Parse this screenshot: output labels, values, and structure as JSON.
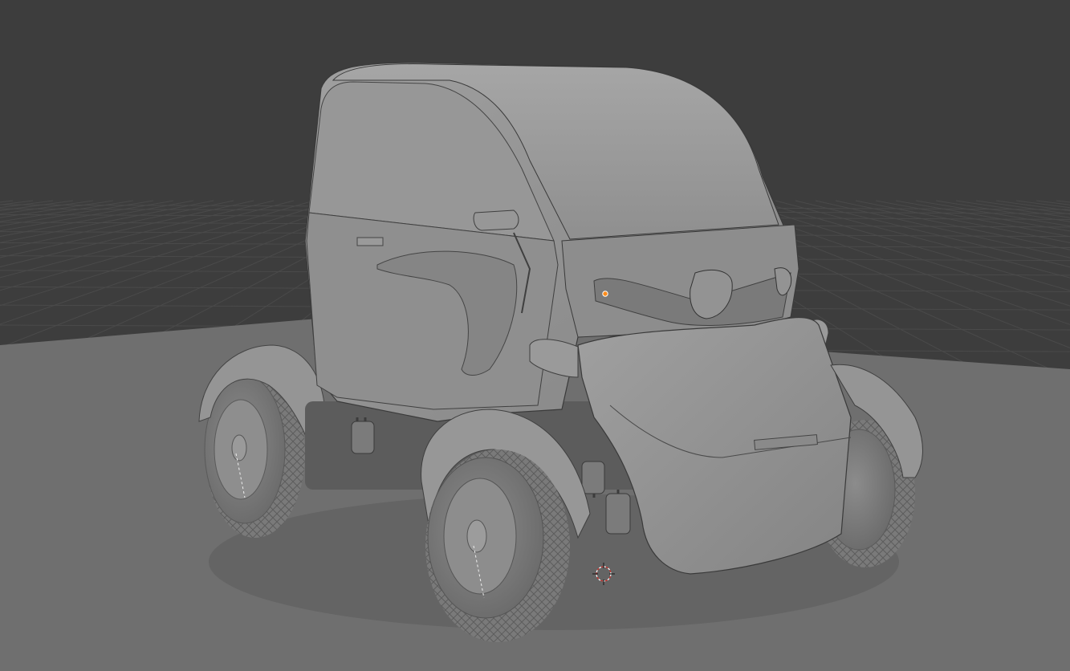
{
  "viewport": {
    "background": "#3d3d3d",
    "grid_color": "#4a4a4a",
    "ground_color": "#6e6e6e",
    "model_base_color": "#8a8a8a",
    "model_light_color": "#9c9c9c",
    "edge_color": "#2f2f2f",
    "origin_dot_color": "#ff8c1a",
    "cursor_color": "#d0302a"
  },
  "scene": {
    "object": "car-model",
    "cursor_icon": "3d-cursor-icon",
    "origin_icon": "object-origin-icon"
  }
}
